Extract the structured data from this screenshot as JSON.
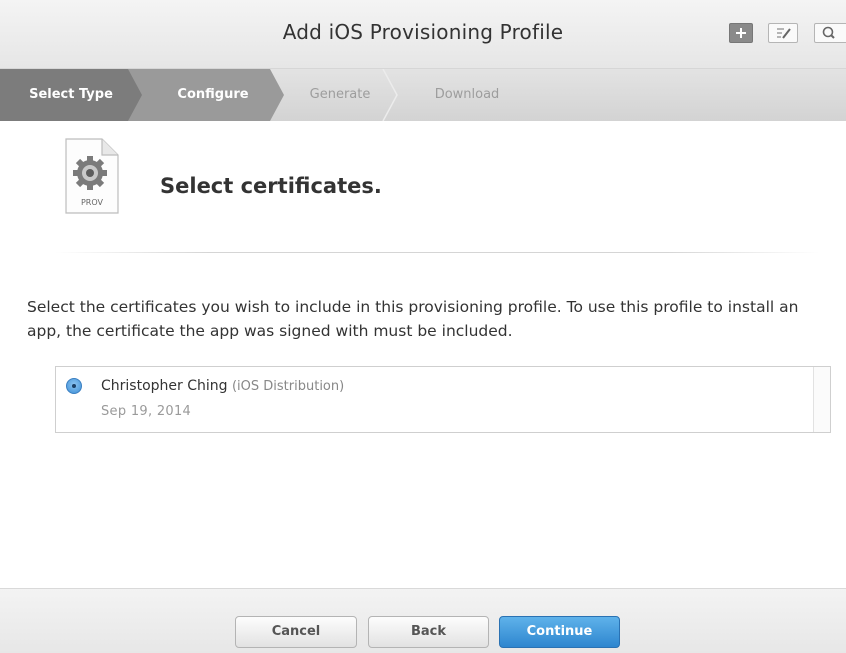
{
  "window": {
    "title": "Add iOS Provisioning Profile",
    "toolbar_icons": [
      "add-icon",
      "edit-icon",
      "search-icon"
    ]
  },
  "steps": [
    {
      "label": "Select Type",
      "state": "completed"
    },
    {
      "label": "Configure",
      "state": "current"
    },
    {
      "label": "Generate",
      "state": "upcoming"
    },
    {
      "label": "Download",
      "state": "upcoming"
    }
  ],
  "header": {
    "icon_label": "PROV",
    "title": "Select certificates."
  },
  "description": "Select the certificates you wish to include in this provisioning profile. To use this profile to install an app, the certificate the app was signed with must be included.",
  "certificates": [
    {
      "name": "Christopher Ching",
      "type": "(iOS Distribution)",
      "date": "Sep 19, 2014",
      "selected": true
    }
  ],
  "footer": {
    "cancel_label": "Cancel",
    "back_label": "Back",
    "continue_label": "Continue"
  },
  "colors": {
    "accent": "#2e86cf",
    "step_completed": "#7c7c7c",
    "step_current": "#9a9a9a"
  }
}
